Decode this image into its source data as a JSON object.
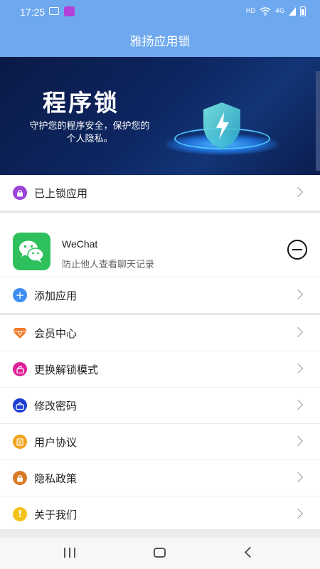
{
  "status_bar": {
    "time": "17:25",
    "network_label": "HD",
    "signal_label": "4G"
  },
  "header": {
    "title": "雅扬应用锁"
  },
  "banner": {
    "title": "程序锁",
    "subtitle": "守护您的程序安全，保护您的个人隐私。"
  },
  "locked_apps": {
    "label": "已上锁应用"
  },
  "app": {
    "name": "WeChat",
    "description": "防止他人查看聊天记录"
  },
  "add_app": {
    "label": "添加应用"
  },
  "menu": {
    "vip": "会员中心",
    "unlock_mode": "更换解锁模式",
    "change_password": "修改密码",
    "user_agreement": "用户协议",
    "privacy_policy": "隐私政策",
    "about_us": "关于我们"
  },
  "colors": {
    "header": "#6ea8ee",
    "locked_icon": "#9b44d8",
    "add_icon": "#3d8df2",
    "vip_icon": "#f07c2a",
    "unlock_icon": "#e0219a",
    "password_icon": "#1d3fd1",
    "agreement_icon": "#f2a31e",
    "privacy_icon": "#d97a25",
    "about_icon": "#f2c31b",
    "wechat": "#2ec05c"
  }
}
